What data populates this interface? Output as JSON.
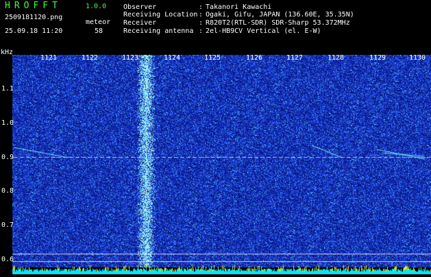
{
  "header": {
    "app_name": "HROFFT",
    "app_version": "1.0.0",
    "file_name": "2509181120.png",
    "datetime": "25.09.18 11:20",
    "meteor_label": "meteor",
    "meteor_count": "58",
    "info": [
      {
        "key": "Observer",
        "value": "Takanori Kawachi"
      },
      {
        "key": "Receiving Location",
        "value": "Ogaki, Gifu, JAPAN (136.60E, 35.35N)"
      },
      {
        "key": "Receiver",
        "value": "R820T2(RTL-SDR) SDR-Sharp 53.372MHz"
      },
      {
        "key": "Receiving antenna",
        "value": "2el-HB9CV Vertical (el. E-W)"
      }
    ]
  },
  "plot": {
    "unit_label": "kHz",
    "time_ticks": [
      "1121",
      "1122",
      "1123",
      "1124",
      "1125",
      "1126",
      "1127",
      "1128",
      "1129",
      "1130"
    ],
    "freq_ticks": [
      "1.1",
      "1.0",
      "0.9",
      "0.8",
      "0.7",
      "0.6"
    ],
    "colors": {
      "background": "#0a1a8a",
      "noise": "#2f55ff",
      "signal": "#8fe8ff",
      "baseline": "#00e5ff",
      "hot": "#ffe600"
    }
  }
}
